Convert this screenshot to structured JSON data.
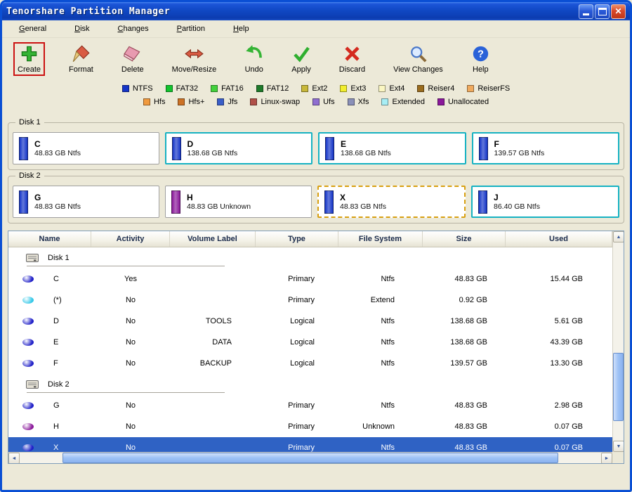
{
  "window": {
    "title": "Tenorshare Partition Manager",
    "controls": [
      {
        "name": "minimize"
      },
      {
        "name": "maximize"
      },
      {
        "name": "close"
      }
    ]
  },
  "menu": {
    "items": [
      {
        "label": "General"
      },
      {
        "label": "Disk"
      },
      {
        "label": "Changes"
      },
      {
        "label": "Partition"
      },
      {
        "label": "Help"
      }
    ]
  },
  "toolbar": {
    "items": [
      {
        "label": "Create",
        "icon": "create-icon",
        "highlighted": true
      },
      {
        "label": "Format",
        "icon": "format-icon"
      },
      {
        "label": "Delete",
        "icon": "delete-icon"
      },
      {
        "label": "Move/Resize",
        "icon": "move-resize-icon"
      },
      {
        "label": "Undo",
        "icon": "undo-icon"
      },
      {
        "label": "Apply",
        "icon": "apply-icon"
      },
      {
        "label": "Discard",
        "icon": "discard-icon"
      },
      {
        "label": "View Changes",
        "icon": "view-changes-icon"
      },
      {
        "label": "Help",
        "icon": "help-icon"
      }
    ]
  },
  "legend": {
    "row1": [
      {
        "label": "NTFS",
        "color": "#1535c8"
      },
      {
        "label": "FAT32",
        "color": "#12c42e"
      },
      {
        "label": "FAT16",
        "color": "#43d13c"
      },
      {
        "label": "FAT12",
        "color": "#1e7a2a"
      },
      {
        "label": "Ext2",
        "color": "#c8b83a"
      },
      {
        "label": "Ext3",
        "color": "#f2ee2e"
      },
      {
        "label": "Ext4",
        "color": "#faf6c2"
      },
      {
        "label": "Reiser4",
        "color": "#9a6c1e"
      },
      {
        "label": "ReiserFS",
        "color": "#f0aa5e"
      }
    ],
    "row2": [
      {
        "label": "Hfs",
        "color": "#f09a3e"
      },
      {
        "label": "Hfs+",
        "color": "#cc7226"
      },
      {
        "label": "Jfs",
        "color": "#3a5ec8"
      },
      {
        "label": "Linux-swap",
        "color": "#b05048"
      },
      {
        "label": "Ufs",
        "color": "#8f6ed0"
      },
      {
        "label": "Xfs",
        "color": "#8a90b8"
      },
      {
        "label": "Extended",
        "color": "#a8eef5"
      },
      {
        "label": "Unallocated",
        "color": "#8a189a"
      }
    ]
  },
  "disks": [
    {
      "name": "Disk 1",
      "partitions": [
        {
          "letter": "C",
          "info": "48.83 GB Ntfs",
          "bar_color": "#1535c8",
          "border": "plain"
        },
        {
          "letter": "D",
          "info": "138.68 GB Ntfs",
          "bar_color": "#1535c8",
          "border": "teal"
        },
        {
          "letter": "E",
          "info": "138.68 GB Ntfs",
          "bar_color": "#1535c8",
          "border": "teal"
        },
        {
          "letter": "F",
          "info": "139.57 GB Ntfs",
          "bar_color": "#1535c8",
          "border": "teal"
        }
      ]
    },
    {
      "name": "Disk 2",
      "partitions": [
        {
          "letter": "G",
          "info": "48.83 GB Ntfs",
          "bar_color": "#1535c8",
          "border": "plain"
        },
        {
          "letter": "H",
          "info": "48.83 GB Unknown",
          "bar_color": "#8a189a",
          "border": "plain"
        },
        {
          "letter": "X",
          "info": "48.83 GB Ntfs",
          "bar_color": "#1535c8",
          "border": "selected"
        },
        {
          "letter": "J",
          "info": "86.40 GB Ntfs",
          "bar_color": "#1535c8",
          "border": "teal"
        }
      ]
    }
  ],
  "table": {
    "headers": [
      "Name",
      "Activity",
      "Volume Label",
      "Type",
      "File System",
      "Size",
      "Used"
    ],
    "rows": [
      {
        "kind": "group",
        "name": "Disk 1"
      },
      {
        "kind": "partition",
        "icon_color": "#2020c8",
        "name": "C",
        "activity": "Yes",
        "volume_label": "",
        "type": "Primary",
        "file_system": "Ntfs",
        "size": "48.83 GB",
        "used": "15.44 GB"
      },
      {
        "kind": "partition",
        "icon_color": "#35c8e8",
        "name": "(*)",
        "activity": "No",
        "volume_label": "",
        "type": "Primary",
        "file_system": "Extend",
        "size": "0.92 GB",
        "used": ""
      },
      {
        "kind": "partition",
        "icon_color": "#2020c8",
        "name": "D",
        "activity": "No",
        "volume_label": "TOOLS",
        "type": "Logical",
        "file_system": "Ntfs",
        "size": "138.68 GB",
        "used": "5.61 GB"
      },
      {
        "kind": "partition",
        "icon_color": "#2020c8",
        "name": "E",
        "activity": "No",
        "volume_label": "DATA",
        "type": "Logical",
        "file_system": "Ntfs",
        "size": "138.68 GB",
        "used": "43.39 GB"
      },
      {
        "kind": "partition",
        "icon_color": "#2020c8",
        "name": "F",
        "activity": "No",
        "volume_label": "BACKUP",
        "type": "Logical",
        "file_system": "Ntfs",
        "size": "139.57 GB",
        "used": "13.30 GB"
      },
      {
        "kind": "group",
        "name": "Disk 2"
      },
      {
        "kind": "partition",
        "icon_color": "#2020c8",
        "name": "G",
        "activity": "No",
        "volume_label": "",
        "type": "Primary",
        "file_system": "Ntfs",
        "size": "48.83 GB",
        "used": "2.98 GB"
      },
      {
        "kind": "partition",
        "icon_color": "#8a189a",
        "name": "H",
        "activity": "No",
        "volume_label": "",
        "type": "Primary",
        "file_system": "Unknown",
        "size": "48.83 GB",
        "used": "0.07 GB"
      },
      {
        "kind": "partition",
        "selected": true,
        "icon_color": "#2020c8",
        "name": "X",
        "activity": "No",
        "volume_label": "",
        "type": "Primary",
        "file_system": "Ntfs",
        "size": "48.83 GB",
        "used": "0.07 GB"
      }
    ]
  }
}
